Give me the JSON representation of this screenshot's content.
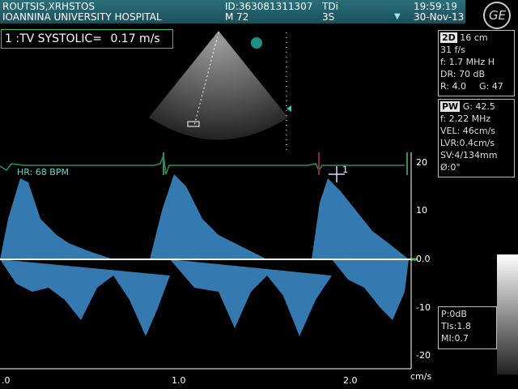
{
  "header": {
    "patient_name": "ROUTSIS,XRHSTOS",
    "hospital": "IOANNINA UNIVERSITY HOSPITAL",
    "patient_id": "ID:363081311307",
    "age_sex": "M 72",
    "mode": "TDi",
    "probe": "3S",
    "time": "19:59:19",
    "date": "30-Nov-13",
    "logo": "GE"
  },
  "measurement": {
    "label": "1 :TV SYSTOLIC=",
    "value": "0.17 m/s"
  },
  "panel_2d": {
    "tag": "2D",
    "depth": "16 cm",
    "frame_rate": "31 f/s",
    "frequency": "f: 1.7 MHz H",
    "dynamic_range": "DR: 70 dB",
    "reject": "R: 4.0",
    "gain": "G: 47"
  },
  "panel_pw": {
    "tag": "PW",
    "gain": "G: 42.5",
    "frequency": "f: 2.22 MHz",
    "velocity": "VEL: 46cm/s",
    "lvr": "LVR:0.4cm/s",
    "sample_volume": "SV:4/134mm",
    "angle": "Ø:0°"
  },
  "panel_power": {
    "power": "P:0dB",
    "tis": "TIs:1.8",
    "mi": "MI:0.7"
  },
  "ecg": {
    "heart_rate": "HR: 68 BPM",
    "color": "#2f8f55"
  },
  "scale": {
    "y_ticks": [
      "20",
      "10",
      "0.0",
      "-10",
      "-20"
    ],
    "y_unit": "cm/s",
    "x_ticks": [
      ".0",
      "1.0",
      "2.0"
    ]
  },
  "cursor_label": "1",
  "colors": {
    "header_bg": "#2a6f7b",
    "measure_border": "#45c15c",
    "doppler": "#4aa6e6"
  },
  "icons": [
    "ge-logo-icon",
    "cursor-cross-icon",
    "marker-dot-icon"
  ]
}
